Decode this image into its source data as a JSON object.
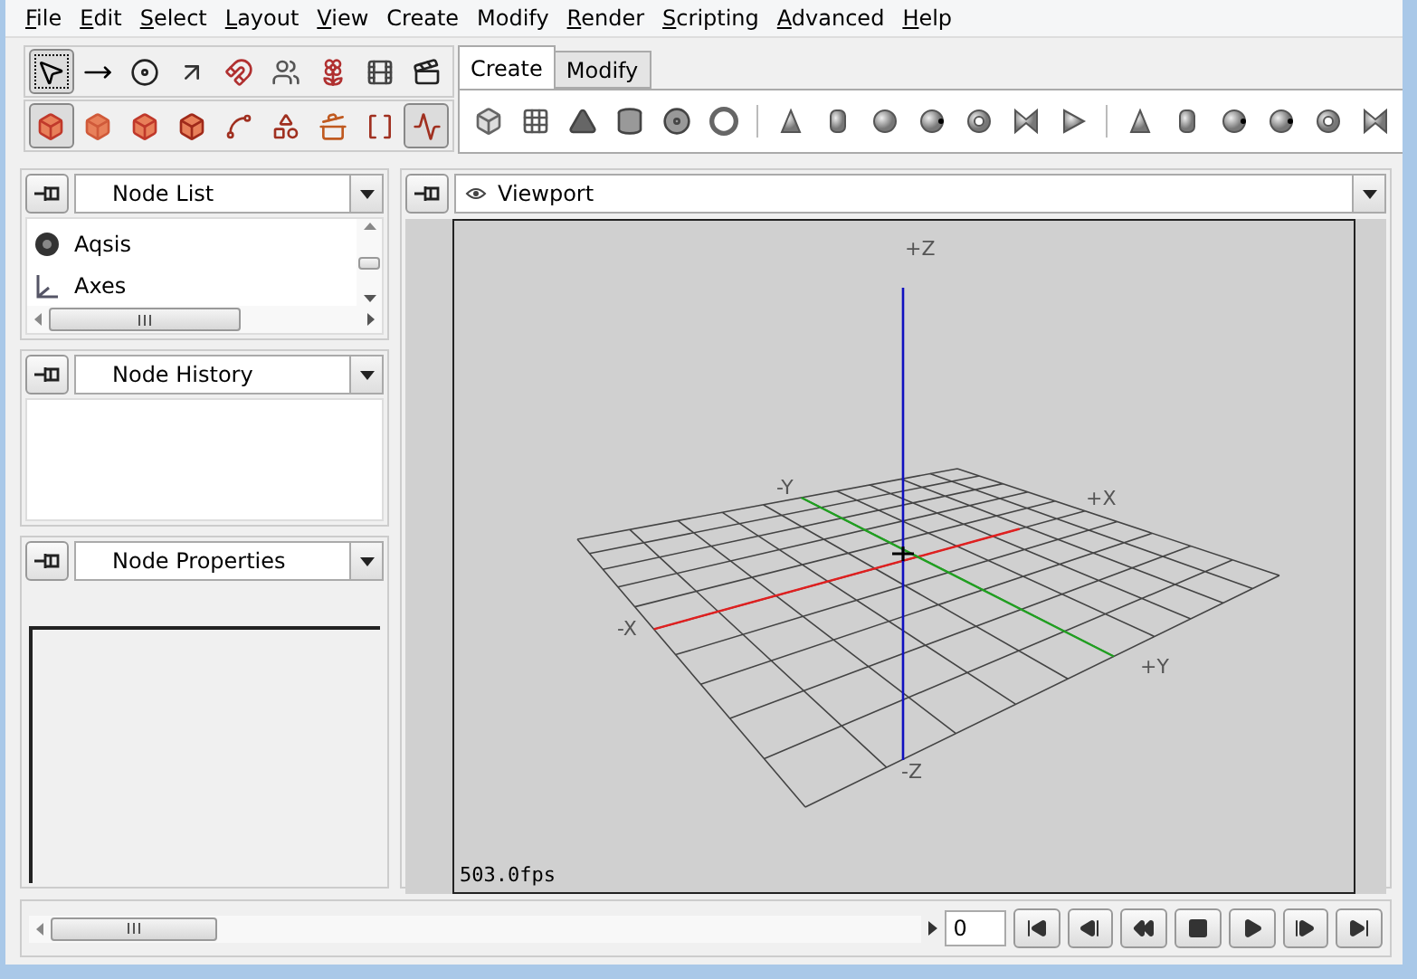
{
  "menu": [
    {
      "label": "File",
      "underlined": true
    },
    {
      "label": "Edit",
      "underlined": true
    },
    {
      "label": "Select",
      "underlined": true
    },
    {
      "label": "Layout",
      "underlined": true
    },
    {
      "label": "View",
      "underlined": true
    },
    {
      "label": "Create",
      "underlined": false
    },
    {
      "label": "Modify",
      "underlined": false
    },
    {
      "label": "Render",
      "underlined": true
    },
    {
      "label": "Scripting",
      "underlined": true
    },
    {
      "label": "Advanced",
      "underlined": true
    },
    {
      "label": "Help",
      "underlined": true
    }
  ],
  "toolbar_row_1": [
    {
      "selected": true
    },
    {
      "selected": false
    },
    {
      "selected": false
    },
    {
      "selected": false
    },
    {
      "selected": false
    },
    {
      "selected": false
    },
    {
      "selected": false
    },
    {
      "selected": false
    },
    {
      "selected": false
    }
  ],
  "toolbar_row_2": [
    {
      "selected": true
    },
    {
      "selected": false
    },
    {
      "selected": false
    },
    {
      "selected": false
    },
    {
      "selected": false
    },
    {
      "selected": false
    },
    {
      "selected": false
    },
    {
      "selected": false
    },
    {
      "selected": true
    }
  ],
  "tabs": [
    {
      "label": "Create",
      "selected": true
    },
    {
      "label": "Modify",
      "selected": false
    }
  ],
  "node_list": {
    "title": "Node List",
    "items": [
      "Aqsis",
      "Axes"
    ]
  },
  "node_history": {
    "title": "Node History"
  },
  "node_properties": {
    "title": "Node Properties"
  },
  "viewport": {
    "title": "Viewport",
    "axis_labels": {
      "plus_z": "+Z",
      "minus_z": "-Z",
      "plus_x": "+X",
      "minus_x": "-X",
      "plus_y": "+Y",
      "minus_y": "-Y"
    },
    "fps": "503.0fps"
  },
  "timeline": {
    "frame": "0"
  }
}
